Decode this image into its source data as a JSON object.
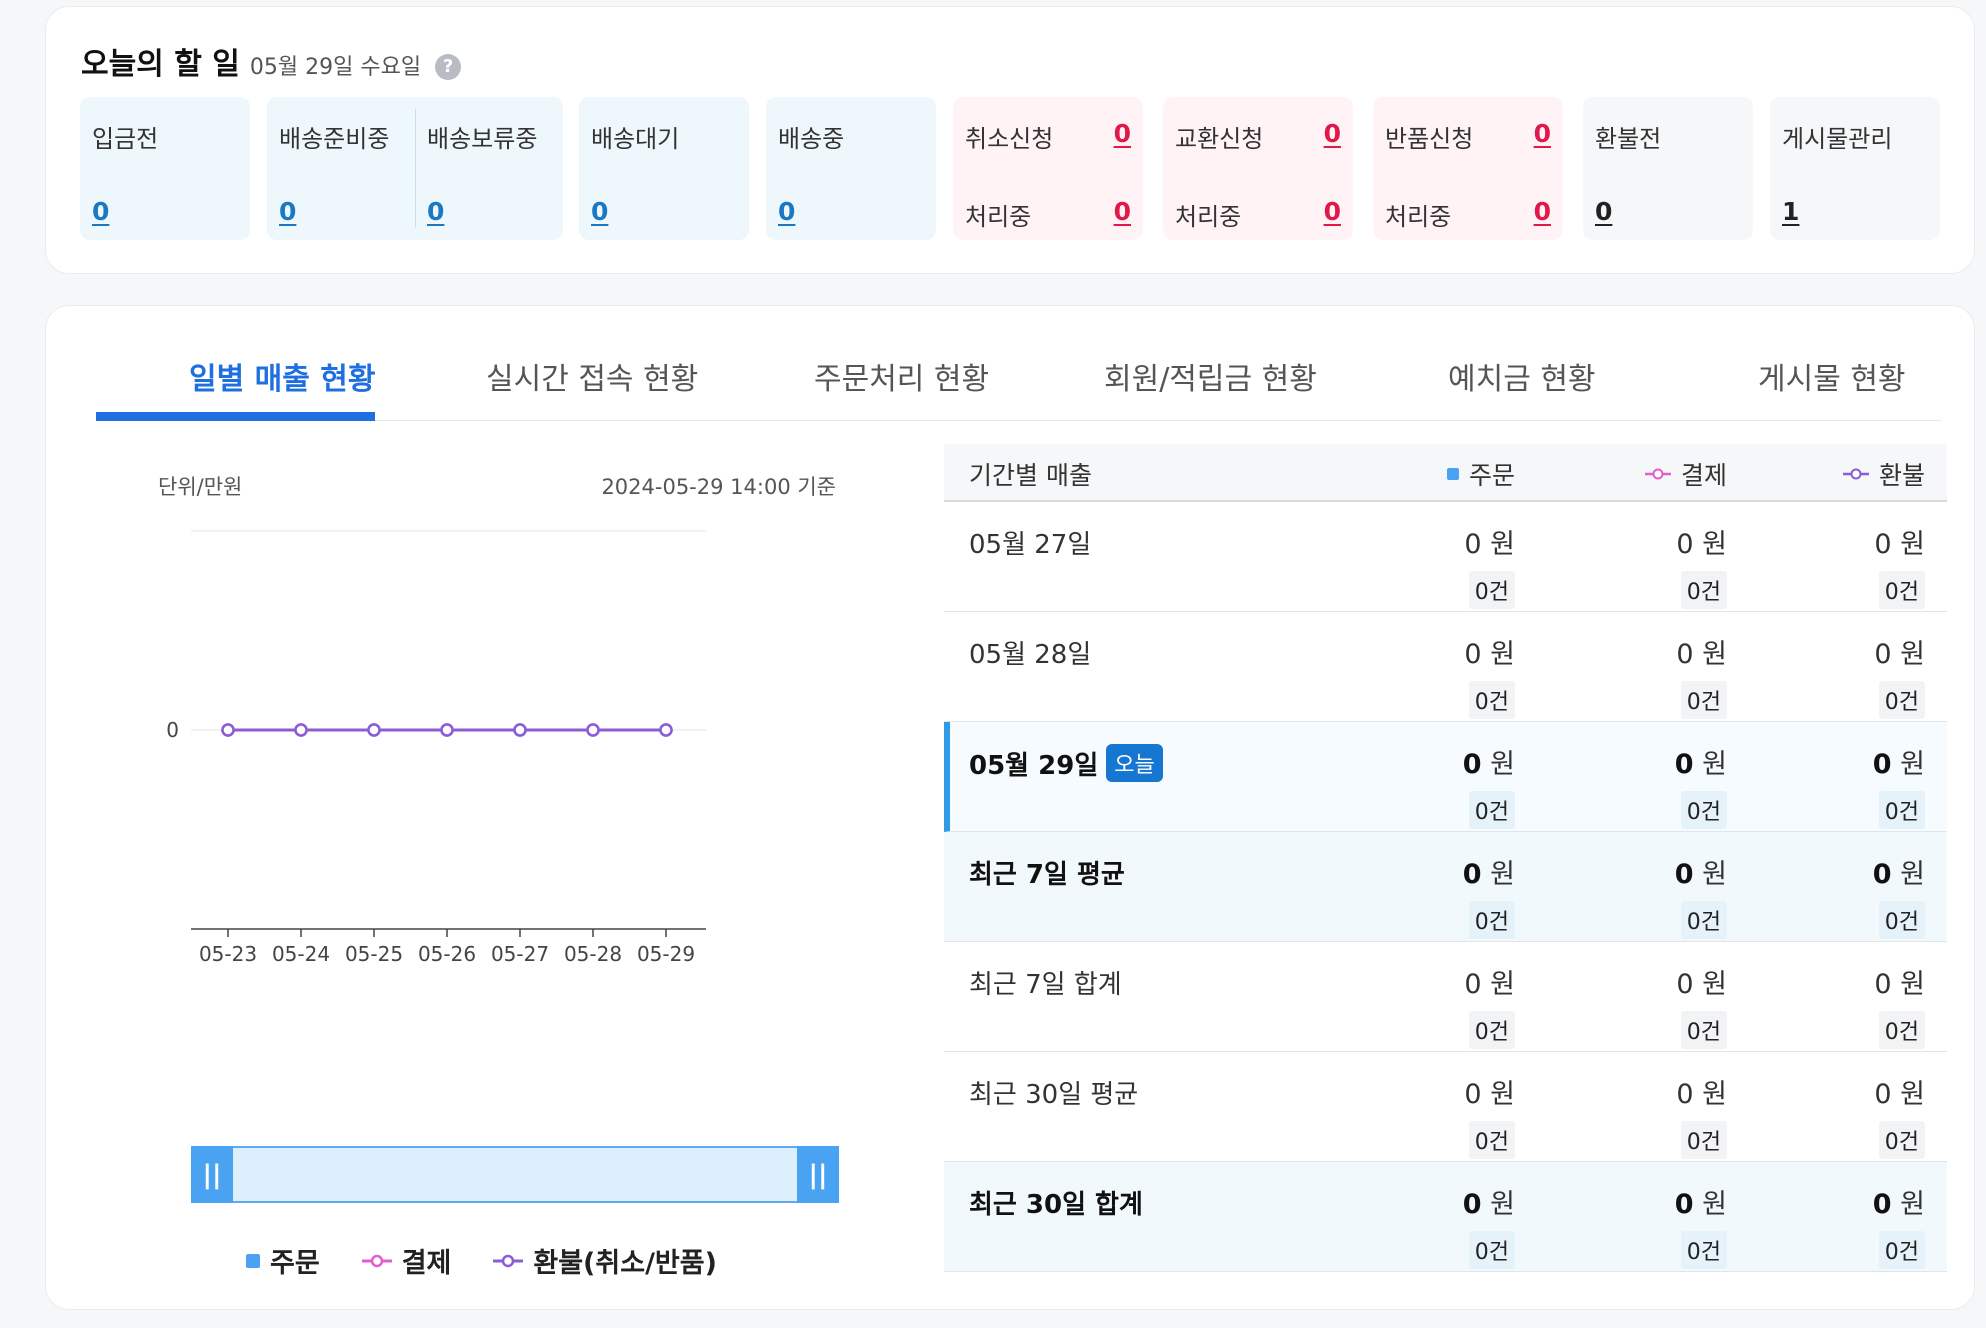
{
  "todo": {
    "title": "오늘의 할 일",
    "date": "05월 29일 수요일",
    "help_icon": "?",
    "tiles": {
      "deposit": {
        "label": "입금전",
        "value": "0"
      },
      "prep": {
        "label": "배송준비중",
        "value": "0"
      },
      "hold": {
        "label": "배송보류중",
        "value": "0"
      },
      "wait": {
        "label": "배송대기",
        "value": "0"
      },
      "shipping": {
        "label": "배송중",
        "value": "0"
      },
      "cancel": {
        "label": "취소신청",
        "value": "0",
        "sub_label": "처리중",
        "sub_value": "0"
      },
      "exchange": {
        "label": "교환신청",
        "value": "0",
        "sub_label": "처리중",
        "sub_value": "0"
      },
      "return": {
        "label": "반품신청",
        "value": "0",
        "sub_label": "처리중",
        "sub_value": "0"
      },
      "refund": {
        "label": "환불전",
        "value": "0"
      },
      "board": {
        "label": "게시물관리",
        "value": "1"
      }
    }
  },
  "tabs": [
    "일별 매출 현황",
    "실시간 접속 현황",
    "주문처리 현황",
    "회원/적립금 현황",
    "예치금 현황",
    "게시물 현황"
  ],
  "chart": {
    "unit": "단위/만원",
    "as_of": "2024-05-29 14:00 기준",
    "legend": [
      "주문",
      "결제",
      "환불(취소/반품)"
    ]
  },
  "chart_data": {
    "type": "line",
    "x": [
      "05-23",
      "05-24",
      "05-25",
      "05-26",
      "05-27",
      "05-28",
      "05-29"
    ],
    "y_ticks": [
      "0"
    ],
    "series": [
      {
        "name": "주문",
        "values": [
          0,
          0,
          0,
          0,
          0,
          0,
          0
        ],
        "color": "#4aa3f2"
      },
      {
        "name": "결제",
        "values": [
          0,
          0,
          0,
          0,
          0,
          0,
          0
        ],
        "color": "#e05fd0"
      },
      {
        "name": "환불(취소/반품)",
        "values": [
          0,
          0,
          0,
          0,
          0,
          0,
          0
        ],
        "color": "#8b5cd6"
      }
    ]
  },
  "table": {
    "headers": {
      "period": "기간별 매출",
      "order": "주문",
      "payment": "결제",
      "refund": "환불"
    },
    "unit_won": "원",
    "rows": [
      {
        "label": "05월 27일",
        "order": "0",
        "order_cnt": "0건",
        "payment": "0",
        "payment_cnt": "0건",
        "refund": "0",
        "refund_cnt": "0건"
      },
      {
        "label": "05월 28일",
        "order": "0",
        "order_cnt": "0건",
        "payment": "0",
        "payment_cnt": "0건",
        "refund": "0",
        "refund_cnt": "0건"
      },
      {
        "label": "05월 29일",
        "badge": "오늘",
        "order": "0",
        "order_cnt": "0건",
        "payment": "0",
        "payment_cnt": "0건",
        "refund": "0",
        "refund_cnt": "0건"
      },
      {
        "label": "최근 7일 평균",
        "order": "0",
        "order_cnt": "0건",
        "payment": "0",
        "payment_cnt": "0건",
        "refund": "0",
        "refund_cnt": "0건"
      },
      {
        "label": "최근 7일 합계",
        "order": "0",
        "order_cnt": "0건",
        "payment": "0",
        "payment_cnt": "0건",
        "refund": "0",
        "refund_cnt": "0건"
      },
      {
        "label": "최근 30일 평균",
        "order": "0",
        "order_cnt": "0건",
        "payment": "0",
        "payment_cnt": "0건",
        "refund": "0",
        "refund_cnt": "0건"
      },
      {
        "label": "최근 30일 합계",
        "order": "0",
        "order_cnt": "0건",
        "payment": "0",
        "payment_cnt": "0건",
        "refund": "0",
        "refund_cnt": "0건"
      }
    ]
  }
}
